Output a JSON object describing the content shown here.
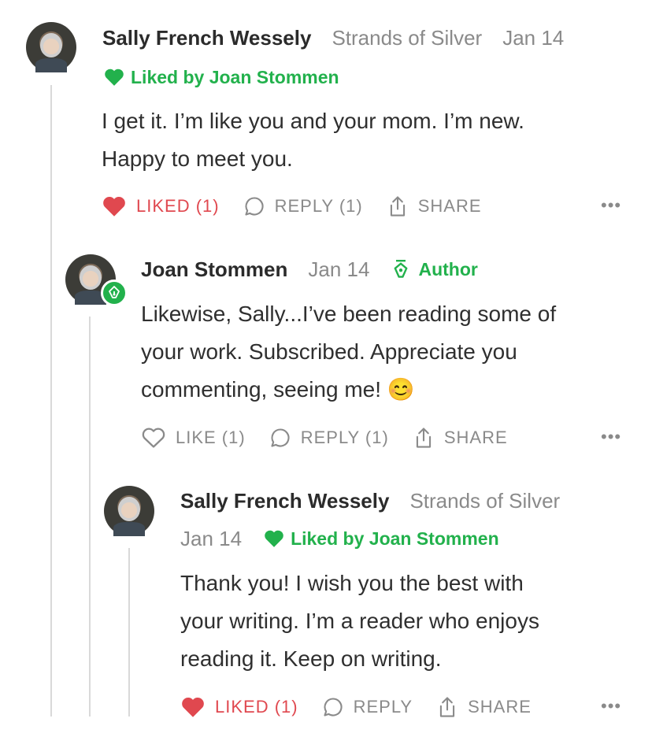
{
  "comments": [
    {
      "author": "Sally French Wessely",
      "publication": "Strands of Silver",
      "date": "Jan 14",
      "liked_by": "Liked by Joan Stommen",
      "text_lines": [
        "I get it. I’m like you and your mom. I’m new.",
        "Happy to meet you."
      ],
      "actions": {
        "like": "LIKED (1)",
        "reply": "REPLY (1)",
        "share": "SHARE",
        "more": "•••"
      }
    },
    {
      "author": "Joan Stommen",
      "date": "Jan 14",
      "author_tag": "Author",
      "text_lines": [
        "Likewise, Sally...I’ve been reading some of",
        "your work. Subscribed. Appreciate you",
        "commenting, seeing me! 😊"
      ],
      "actions": {
        "like": "LIKE (1)",
        "reply": "REPLY (1)",
        "share": "SHARE",
        "more": "•••"
      }
    },
    {
      "author": "Sally French Wessely",
      "publication": "Strands of Silver",
      "date": "Jan 14",
      "liked_by": "Liked by Joan Stommen",
      "text_lines": [
        "Thank you! I wish you the best with",
        "your writing. I’m a reader who enjoys",
        "reading it. Keep on writing."
      ],
      "actions": {
        "like": "LIKED (1)",
        "reply": "REPLY",
        "share": "SHARE",
        "more": "•••"
      }
    }
  ],
  "colors": {
    "liked": "#e0484f",
    "green": "#22b14c",
    "muted": "#8a8a8a"
  }
}
